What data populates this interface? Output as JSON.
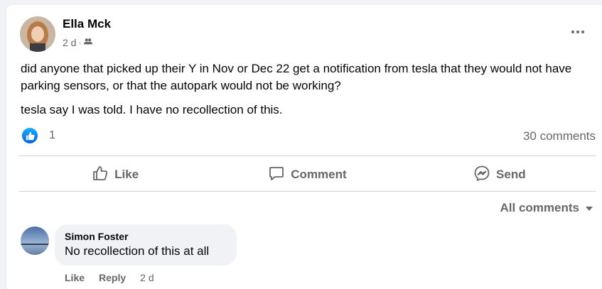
{
  "post": {
    "author": "Ella Mck",
    "time": "2 d",
    "separator": "·",
    "audience_icon": "friends-icon",
    "text_lines": [
      "did anyone that picked up their Y in Nov or Dec 22 get a notification from tesla that they would not have parking sensors, or that the autopark would not be working?",
      "tesla say I was told. I have no recollection of this."
    ],
    "reaction_count": "1",
    "comments_count": "30 comments"
  },
  "actions": {
    "like": "Like",
    "comment": "Comment",
    "send": "Send"
  },
  "filter": {
    "label": "All comments"
  },
  "comment": {
    "author": "Simon Foster",
    "text": "No recollection of this at all",
    "like": "Like",
    "reply": "Reply",
    "time": "2 d"
  },
  "colors": {
    "accent": "#1877f2",
    "secondary_text": "#65676b",
    "bubble_bg": "#f0f2f5"
  }
}
